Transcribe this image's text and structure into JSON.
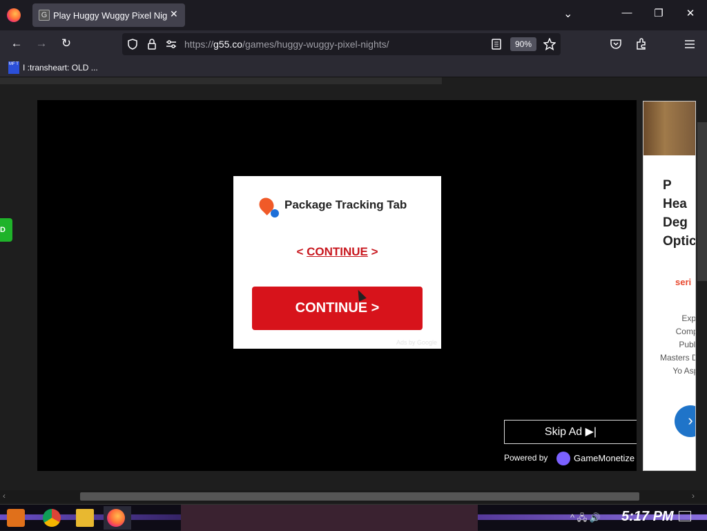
{
  "browser": {
    "tab": {
      "title": "Play Huggy Wuggy Pixel Nights",
      "favicon_letter": "G",
      "close_symbol": "✕"
    },
    "tab_list_symbol": "⌄",
    "window_controls": {
      "minimize": "—",
      "maximize": "❐",
      "close": "✕"
    },
    "nav": {
      "back": "←",
      "forward": "→",
      "reload": "↻"
    },
    "url": {
      "prefix": "https://",
      "domain": "g55.co",
      "path": "/games/huggy-wuggy-pixel-nights/"
    },
    "zoom": "90%",
    "toolbar_icons": [
      "shield-icon",
      "lock-icon",
      "permissions-icon",
      "reader-view-icon",
      "bookmark-star-icon",
      "pocket-icon",
      "extensions-icon",
      "menu-icon"
    ],
    "bookmark": {
      "icon_text": "MF T",
      "label": "I :transheart: OLD ..."
    }
  },
  "page": {
    "left_button_text": "D",
    "ad": {
      "title": "Package Tracking Tab",
      "link_left": "<",
      "link_label": "CONTINUE",
      "link_right": ">",
      "button_label": "CONTINUE >",
      "ads_by": "Ads by Google"
    },
    "skip_ad": "Skip Ad ▶|",
    "powered_by": "Powered by",
    "monetize_brand": "GameMonetize",
    "side_ad": {
      "heading_lines": [
        "P",
        "Hea",
        "Deg",
        "Optic"
      ],
      "brand": "seri",
      "description": "Explore Compare Public H Masters D for Yo Aspirat",
      "next_symbol": "›"
    },
    "scroll_left": "‹",
    "scroll_right": "›"
  },
  "taskbar": {
    "apps": [
      "start-icon",
      "chrome-icon",
      "file-explorer-icon",
      "firefox-icon"
    ],
    "tray": "^ 🖧 🔊",
    "clock": "5:17 PM"
  }
}
